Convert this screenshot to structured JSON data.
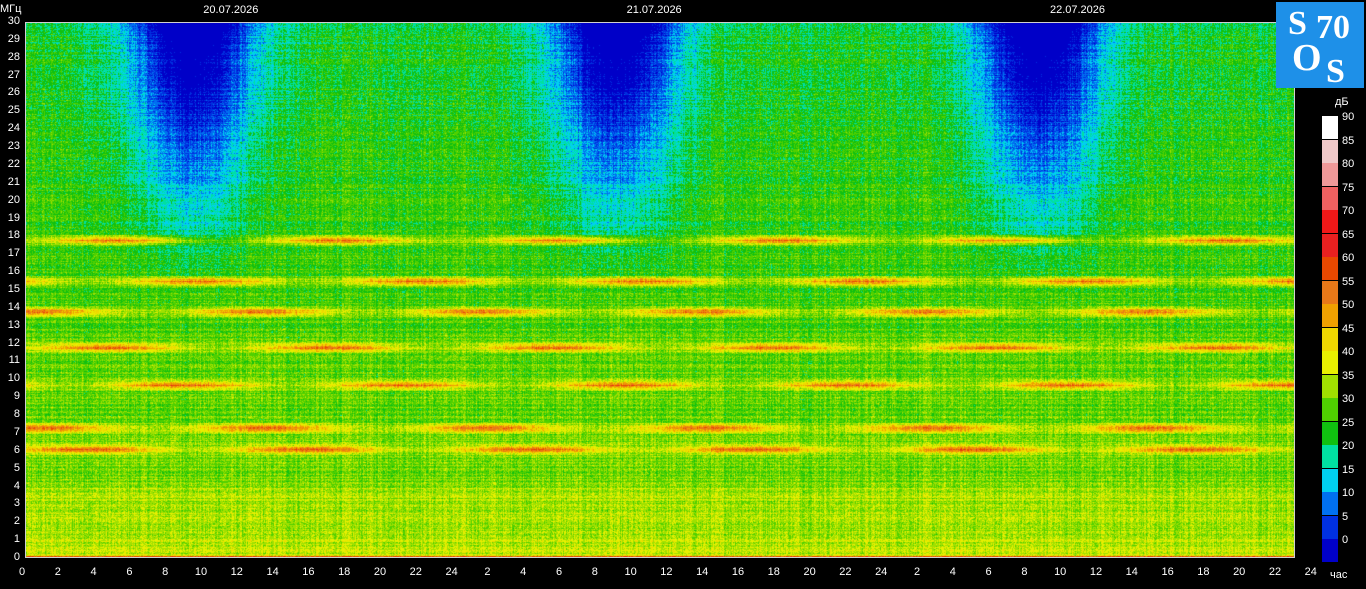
{
  "chart_data": {
    "type": "heatmap",
    "title": "",
    "ylabel": "МГц",
    "xlabel": "час",
    "ylim": [
      0,
      30
    ],
    "xlim": [
      0,
      72
    ],
    "y_ticks": [
      "0",
      "1",
      "2",
      "3",
      "4",
      "5",
      "6",
      "7",
      "8",
      "9",
      "10",
      "11",
      "12",
      "13",
      "14",
      "15",
      "16",
      "17",
      "18",
      "19",
      "20",
      "21",
      "22",
      "23",
      "24",
      "25",
      "26",
      "27",
      "28",
      "29",
      "30"
    ],
    "x_ticks": [
      "0",
      "2",
      "4",
      "6",
      "8",
      "10",
      "12",
      "14",
      "16",
      "18",
      "20",
      "22",
      "24",
      "2",
      "4",
      "6",
      "8",
      "10",
      "12",
      "14",
      "16",
      "18",
      "20",
      "22",
      "24",
      "2",
      "4",
      "6",
      "8",
      "10",
      "12",
      "14",
      "16",
      "18",
      "20",
      "22",
      "24"
    ],
    "dates": [
      "20.07.2026",
      "21.07.2026",
      "22.07.2026"
    ],
    "colorbar": {
      "unit": "дБ",
      "ticks": [
        "90",
        "85",
        "80",
        "75",
        "70",
        "65",
        "60",
        "55",
        "50",
        "45",
        "40",
        "35",
        "30",
        "25",
        "20",
        "15",
        "10",
        "5",
        "0"
      ],
      "colors": [
        "#ffffff",
        "#f0c8c8",
        "#f09898",
        "#f06060",
        "#f01818",
        "#e82020",
        "#e84800",
        "#e87818",
        "#f0a000",
        "#f0d800",
        "#e8f000",
        "#a0e000",
        "#50d000",
        "#10c010",
        "#00e0a0",
        "#00d0f0",
        "#0070f0",
        "#0030e0",
        "#0000c8"
      ]
    },
    "strong_bands_mhz": [
      17.8,
      15.5,
      13.8,
      11.8,
      9.7,
      7.3,
      6.1
    ]
  },
  "logo": {
    "text_s1": "S",
    "text_70": "70",
    "text_o": "O",
    "text_s2": "S"
  }
}
